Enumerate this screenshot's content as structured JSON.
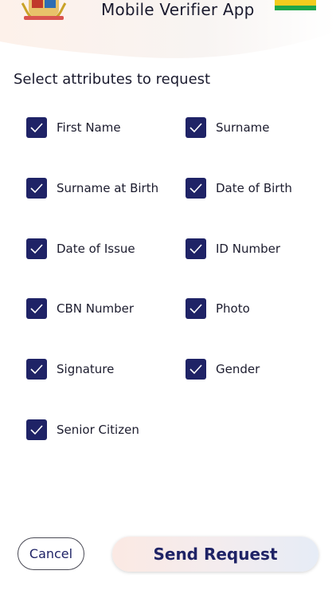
{
  "header": {
    "title": "Mobile Verifier App",
    "crest_icon": "coat-of-arms-icon",
    "flag_icon": "flag-icon",
    "flag_colors": [
      "#f2cc1e",
      "#1ea64a"
    ]
  },
  "section": {
    "title": "Select attributes to request"
  },
  "attributes": [
    {
      "label": "First Name",
      "checked": true
    },
    {
      "label": "Surname",
      "checked": true
    },
    {
      "label": "Surname at Birth",
      "checked": true
    },
    {
      "label": "Date of Birth",
      "checked": true
    },
    {
      "label": "Date of Issue",
      "checked": true
    },
    {
      "label": "ID Number",
      "checked": true
    },
    {
      "label": "CBN Number",
      "checked": true
    },
    {
      "label": "Photo",
      "checked": true
    },
    {
      "label": "Signature",
      "checked": true
    },
    {
      "label": "Gender",
      "checked": true
    },
    {
      "label": "Senior Citizen",
      "checked": true
    }
  ],
  "actions": {
    "cancel_label": "Cancel",
    "send_label": "Send Request"
  },
  "colors": {
    "checkbox": "#1f2366",
    "accent_text": "#1f2366"
  }
}
